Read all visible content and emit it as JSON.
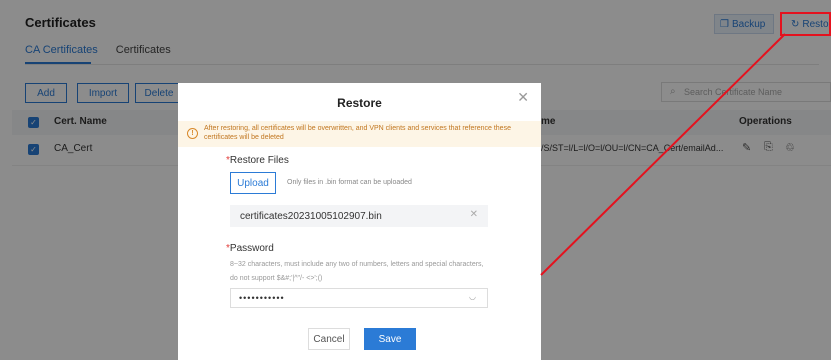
{
  "page": {
    "title": "Certificates",
    "tabs": [
      {
        "label": "CA Certificates",
        "active": true
      },
      {
        "label": "Certificates",
        "active": false
      }
    ],
    "header_buttons": {
      "backup": "Backup",
      "restore": "Restore"
    },
    "toolbar": {
      "add": "Add",
      "import": "Import",
      "delete": "Delete"
    },
    "search_placeholder": "Search Certificate Name",
    "table": {
      "headers": {
        "cert_name": "Cert. Name",
        "name": "me",
        "operations": "Operations"
      },
      "rows": [
        {
          "cert_name": "CA_Cert",
          "name": "/S/ST=l/L=l/O=l/OU=l/CN=CA_Cert/emailAd..."
        }
      ]
    }
  },
  "modal": {
    "title": "Restore",
    "warning": "After restoring, all certificates will be overwritten, and VPN clients and services that reference these certificates will be deleted",
    "restore_files_label": "Restore Files",
    "upload_button": "Upload",
    "upload_hint": "Only files in .bin format can be uploaded",
    "file_name": "certificates20231005102907.bin",
    "password_label": "Password",
    "password_hint": "8~32 characters, must include any two of numbers, letters and special characters, do not support $&#;'|^\"/- <>';()",
    "password_value": "•••••••••••",
    "cancel": "Cancel",
    "save": "Save"
  },
  "colors": {
    "accent": "#2b7bd6",
    "annotation": "#e4121e",
    "warning_bg": "#fdf5e6",
    "warning_text": "#c1761f"
  }
}
